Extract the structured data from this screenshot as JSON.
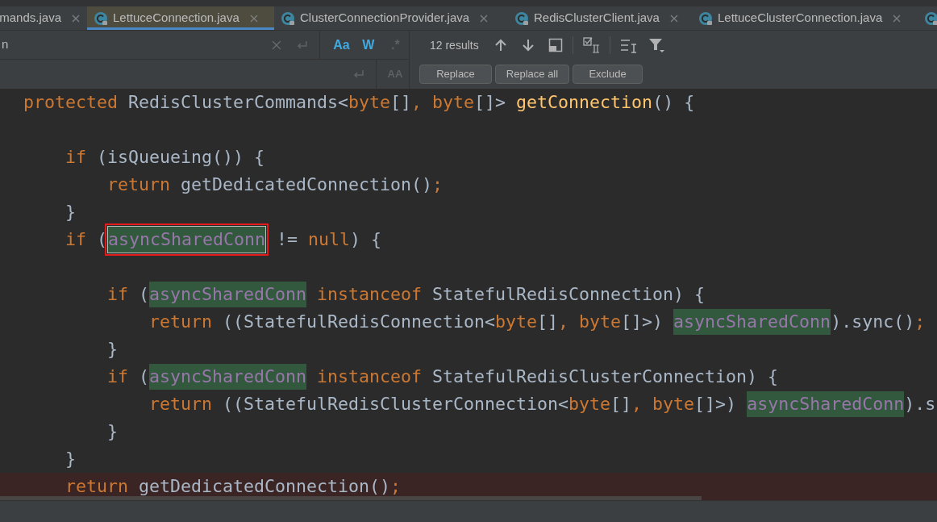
{
  "tabs": [
    {
      "label": "mands.java",
      "selected": false
    },
    {
      "label": "LettuceConnection.java",
      "selected": true
    },
    {
      "label": "ClusterConnectionProvider.java",
      "selected": false
    },
    {
      "label": "RedisClusterClient.java",
      "selected": false
    },
    {
      "label": "LettuceClusterConnection.java",
      "selected": false
    },
    {
      "selected": false
    }
  ],
  "search": {
    "query": "n",
    "toggles": [
      {
        "label": "Aa",
        "on": true
      },
      {
        "label": "W",
        "on": true
      },
      {
        "label": ".*",
        "on": false
      }
    ],
    "preserve_case": {
      "label": "AA",
      "on": false
    },
    "results": "12 results",
    "buttons": [
      "Replace",
      "Replace all",
      "Exclude"
    ]
  },
  "code": [
    {
      "tokens": [
        {
          "kind": "keyword",
          "text": "protected"
        },
        {
          "kind": "plain",
          "text": " RedisClusterCommands<"
        },
        {
          "kind": "keyword",
          "text": "byte"
        },
        {
          "kind": "plain",
          "text": "[]"
        },
        {
          "kind": "keyword",
          "text": ", "
        },
        {
          "kind": "keyword",
          "text": "byte"
        },
        {
          "kind": "plain",
          "text": "[]> "
        },
        {
          "kind": "method",
          "text": "getConnection"
        },
        {
          "kind": "plain",
          "text": "() {"
        }
      ]
    },
    {
      "highlighted": false
    },
    {
      "tokens": [
        {
          "kind": "keyword",
          "text": "    if"
        },
        {
          "kind": "plain",
          "text": " (isQueueing()) {"
        }
      ]
    },
    {
      "tokens": [
        {
          "kind": "keyword",
          "text": "        return"
        },
        {
          "kind": "plain",
          "text": " getDedicatedConnection()"
        },
        {
          "kind": "keyword",
          "text": ";"
        }
      ]
    },
    {
      "tokens": [
        {
          "kind": "plain",
          "text": "    }"
        }
      ]
    },
    {
      "tokens": [
        {
          "kind": "keyword",
          "text": "    if"
        },
        {
          "kind": "plain",
          "text": " ("
        },
        {
          "kind": "match",
          "text": "asyncSharedConn",
          "current": true
        },
        {
          "kind": "plain",
          "text": " != "
        },
        {
          "kind": "keyword",
          "text": "null"
        },
        {
          "kind": "plain",
          "text": ") {"
        }
      ]
    },
    {
      "highlighted": false
    },
    {
      "tokens": [
        {
          "kind": "keyword",
          "text": "        if"
        },
        {
          "kind": "plain",
          "text": " ("
        },
        {
          "kind": "match",
          "text": "asyncSharedConn",
          "current": false
        },
        {
          "kind": "keyword",
          "text": " instanceof"
        },
        {
          "kind": "plain",
          "text": " StatefulRedisConnection) {"
        }
      ]
    },
    {
      "tokens": [
        {
          "kind": "keyword",
          "text": "            return"
        },
        {
          "kind": "plain",
          "text": " ((StatefulRedisConnection<"
        },
        {
          "kind": "keyword",
          "text": "byte"
        },
        {
          "kind": "plain",
          "text": "[]"
        },
        {
          "kind": "keyword",
          "text": ", "
        },
        {
          "kind": "keyword",
          "text": "byte"
        },
        {
          "kind": "plain",
          "text": "[]>) "
        },
        {
          "kind": "match",
          "text": "asyncSharedConn",
          "current": false
        },
        {
          "kind": "plain",
          "text": ").sync()"
        },
        {
          "kind": "keyword",
          "text": ";"
        }
      ]
    },
    {
      "tokens": [
        {
          "kind": "plain",
          "text": "        }"
        }
      ]
    },
    {
      "tokens": [
        {
          "kind": "keyword",
          "text": "        if"
        },
        {
          "kind": "plain",
          "text": " ("
        },
        {
          "kind": "match",
          "text": "asyncSharedConn",
          "current": false
        },
        {
          "kind": "keyword",
          "text": " instanceof"
        },
        {
          "kind": "plain",
          "text": " StatefulRedisClusterConnection) {"
        }
      ]
    },
    {
      "tokens": [
        {
          "kind": "keyword",
          "text": "            return"
        },
        {
          "kind": "plain",
          "text": " ((StatefulRedisClusterConnection<"
        },
        {
          "kind": "keyword",
          "text": "byte"
        },
        {
          "kind": "plain",
          "text": "[]"
        },
        {
          "kind": "keyword",
          "text": ", "
        },
        {
          "kind": "keyword",
          "text": "byte"
        },
        {
          "kind": "plain",
          "text": "[]>) "
        },
        {
          "kind": "match",
          "text": "asyncSharedConn",
          "current": false
        },
        {
          "kind": "plain",
          "text": ").s"
        }
      ]
    },
    {
      "tokens": [
        {
          "kind": "plain",
          "text": "        }"
        }
      ]
    },
    {
      "tokens": [
        {
          "kind": "plain",
          "text": "    }"
        }
      ]
    },
    {
      "highlighted": true,
      "tokens": [
        {
          "kind": "keyword",
          "text": "    return"
        },
        {
          "kind": "plain",
          "text": " getDedicatedConnection()"
        },
        {
          "kind": "keyword",
          "text": ";"
        }
      ]
    }
  ]
}
